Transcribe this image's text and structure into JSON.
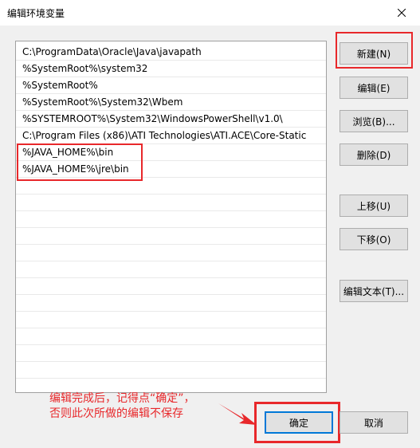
{
  "window": {
    "title": "编辑环境变量",
    "close_icon": "close-icon"
  },
  "paths": [
    "C:\\ProgramData\\Oracle\\Java\\javapath",
    "%SystemRoot%\\system32",
    "%SystemRoot%",
    "%SystemRoot%\\System32\\Wbem",
    "%SYSTEMROOT%\\System32\\WindowsPowerShell\\v1.0\\",
    "C:\\Program Files (x86)\\ATI Technologies\\ATI.ACE\\Core-Static",
    "%JAVA_HOME%\\bin",
    "%JAVA_HOME%\\jre\\bin"
  ],
  "buttons": {
    "new": "新建(N)",
    "edit": "编辑(E)",
    "browse": "浏览(B)...",
    "delete": "删除(D)",
    "move_up": "上移(U)",
    "move_down": "下移(O)",
    "edit_text": "编辑文本(T)...",
    "ok": "确定",
    "cancel": "取消"
  },
  "annotation": {
    "line1": "编辑完成后，记得点“确定”，",
    "line2": "否则此次所做的编辑不保存"
  },
  "colors": {
    "highlight": "#e8282b"
  }
}
